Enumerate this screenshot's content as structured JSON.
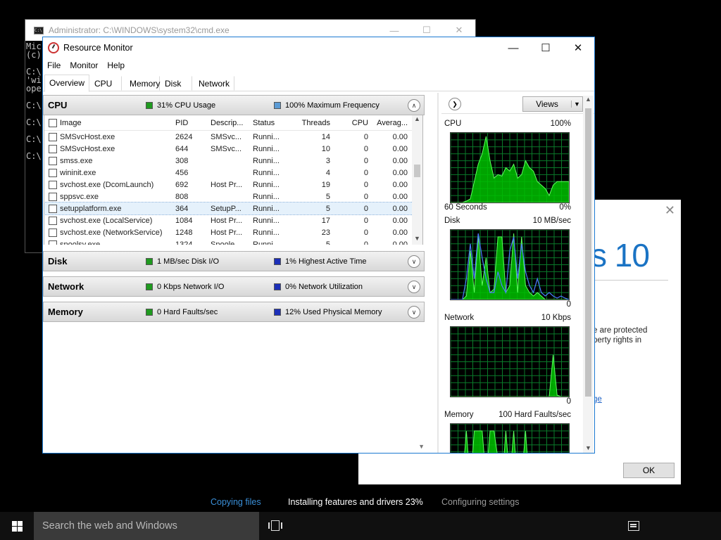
{
  "cmd": {
    "title": "Administrator: C:\\WINDOWS\\system32\\cmd.exe",
    "lines": [
      "Mic",
      "(c)",
      "",
      "C:\\",
      "'wi",
      "ope",
      "",
      "C:\\",
      "",
      "C:\\",
      "",
      "C:\\",
      "",
      "C:\\"
    ]
  },
  "setup": {
    "brand": "s 10",
    "legal": "e are protected\nperty rights in",
    "link": "ge",
    "ok_label": "OK"
  },
  "resmon": {
    "title": "Resource Monitor",
    "menu": [
      "File",
      "Monitor",
      "Help"
    ],
    "tabs": [
      "Overview",
      "CPU",
      "Memory",
      "Disk",
      "Network"
    ],
    "active_tab": "Overview",
    "sections": {
      "cpu": {
        "name": "CPU",
        "ind1": "31% CPU Usage",
        "ind1_color": "#1f9a1f",
        "ind2": "100% Maximum Frequency",
        "ind2_color": "#5b9bd5",
        "expanded": true
      },
      "disk": {
        "name": "Disk",
        "ind1": "1 MB/sec Disk I/O",
        "ind1_color": "#1f9a1f",
        "ind2": "1% Highest Active Time",
        "ind2_color": "#1c2fb8",
        "expanded": false
      },
      "network": {
        "name": "Network",
        "ind1": "0 Kbps Network I/O",
        "ind1_color": "#1f9a1f",
        "ind2": "0% Network Utilization",
        "ind2_color": "#1c2fb8",
        "expanded": false
      },
      "memory": {
        "name": "Memory",
        "ind1": "0 Hard Faults/sec",
        "ind1_color": "#1f9a1f",
        "ind2": "12% Used Physical Memory",
        "ind2_color": "#1c2fb8",
        "expanded": false
      }
    },
    "cpu_columns": [
      "Image",
      "PID",
      "Descrip...",
      "Status",
      "Threads",
      "CPU",
      "Averag..."
    ],
    "cpu_rows": [
      {
        "image": "SMSvcHost.exe",
        "pid": "2624",
        "desc": "SMSvc...",
        "status": "Runni...",
        "threads": "14",
        "cpu": "0",
        "avg": "0.00"
      },
      {
        "image": "SMSvcHost.exe",
        "pid": "644",
        "desc": "SMSvc...",
        "status": "Runni...",
        "threads": "10",
        "cpu": "0",
        "avg": "0.00"
      },
      {
        "image": "smss.exe",
        "pid": "308",
        "desc": "",
        "status": "Runni...",
        "threads": "3",
        "cpu": "0",
        "avg": "0.00"
      },
      {
        "image": "wininit.exe",
        "pid": "456",
        "desc": "",
        "status": "Runni...",
        "threads": "4",
        "cpu": "0",
        "avg": "0.00"
      },
      {
        "image": "svchost.exe (DcomLaunch)",
        "pid": "692",
        "desc": "Host Pr...",
        "status": "Runni...",
        "threads": "19",
        "cpu": "0",
        "avg": "0.00"
      },
      {
        "image": "sppsvc.exe",
        "pid": "808",
        "desc": "",
        "status": "Runni...",
        "threads": "5",
        "cpu": "0",
        "avg": "0.00"
      },
      {
        "image": "setupplatform.exe",
        "pid": "364",
        "desc": "SetupP...",
        "status": "Runni...",
        "threads": "5",
        "cpu": "0",
        "avg": "0.00",
        "selected": true
      },
      {
        "image": "svchost.exe (LocalService)",
        "pid": "1084",
        "desc": "Host Pr...",
        "status": "Runni...",
        "threads": "17",
        "cpu": "0",
        "avg": "0.00"
      },
      {
        "image": "svchost.exe (NetworkService)",
        "pid": "1248",
        "desc": "Host Pr...",
        "status": "Runni...",
        "threads": "23",
        "cpu": "0",
        "avg": "0.00"
      },
      {
        "image": "spoolsv.exe",
        "pid": "1324",
        "desc": "Spoole...",
        "status": "Runni...",
        "threads": "5",
        "cpu": "0",
        "avg": "0.00"
      }
    ],
    "views_label": "Views",
    "graphs": [
      {
        "name": "CPU",
        "max": "100%",
        "foot_left": "60 Seconds",
        "foot_right": "0%"
      },
      {
        "name": "Disk",
        "max": "10 MB/sec",
        "foot_left": "",
        "foot_right": "0"
      },
      {
        "name": "Network",
        "max": "10 Kbps",
        "foot_left": "",
        "foot_right": "0"
      },
      {
        "name": "Memory",
        "max": "100 Hard Faults/sec",
        "foot_left": "",
        "foot_right": ""
      }
    ]
  },
  "progress": {
    "steps": [
      "Copying files",
      "Installing features and drivers 23%",
      "Configuring settings"
    ],
    "colors": [
      "#3a8fd8",
      "#ffffff",
      "#9a9a9a"
    ]
  },
  "taskbar": {
    "search_placeholder": "Search the web and Windows"
  }
}
